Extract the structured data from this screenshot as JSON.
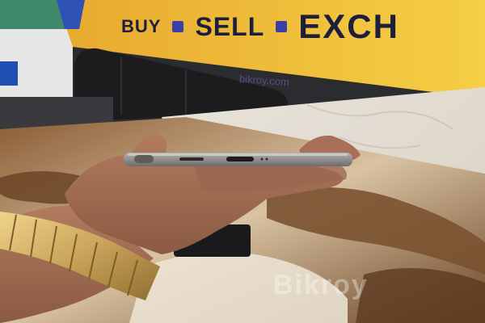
{
  "banner": {
    "word1": "BUY",
    "word2": "SELL",
    "word3": "EXCH",
    "url": "bikroy.com"
  },
  "watermark": "Bikroy",
  "colors": {
    "banner_yellow": "#f2c53d",
    "banner_text": "#1b1f3b",
    "banner_dot": "#3b3fa8",
    "sofa": "#1c1c1e",
    "phone_frame": "#8c8a88",
    "watch_gold": "#c9a35a",
    "marble_top": "#e4ddd2",
    "rug_brown": "#7a5230"
  }
}
